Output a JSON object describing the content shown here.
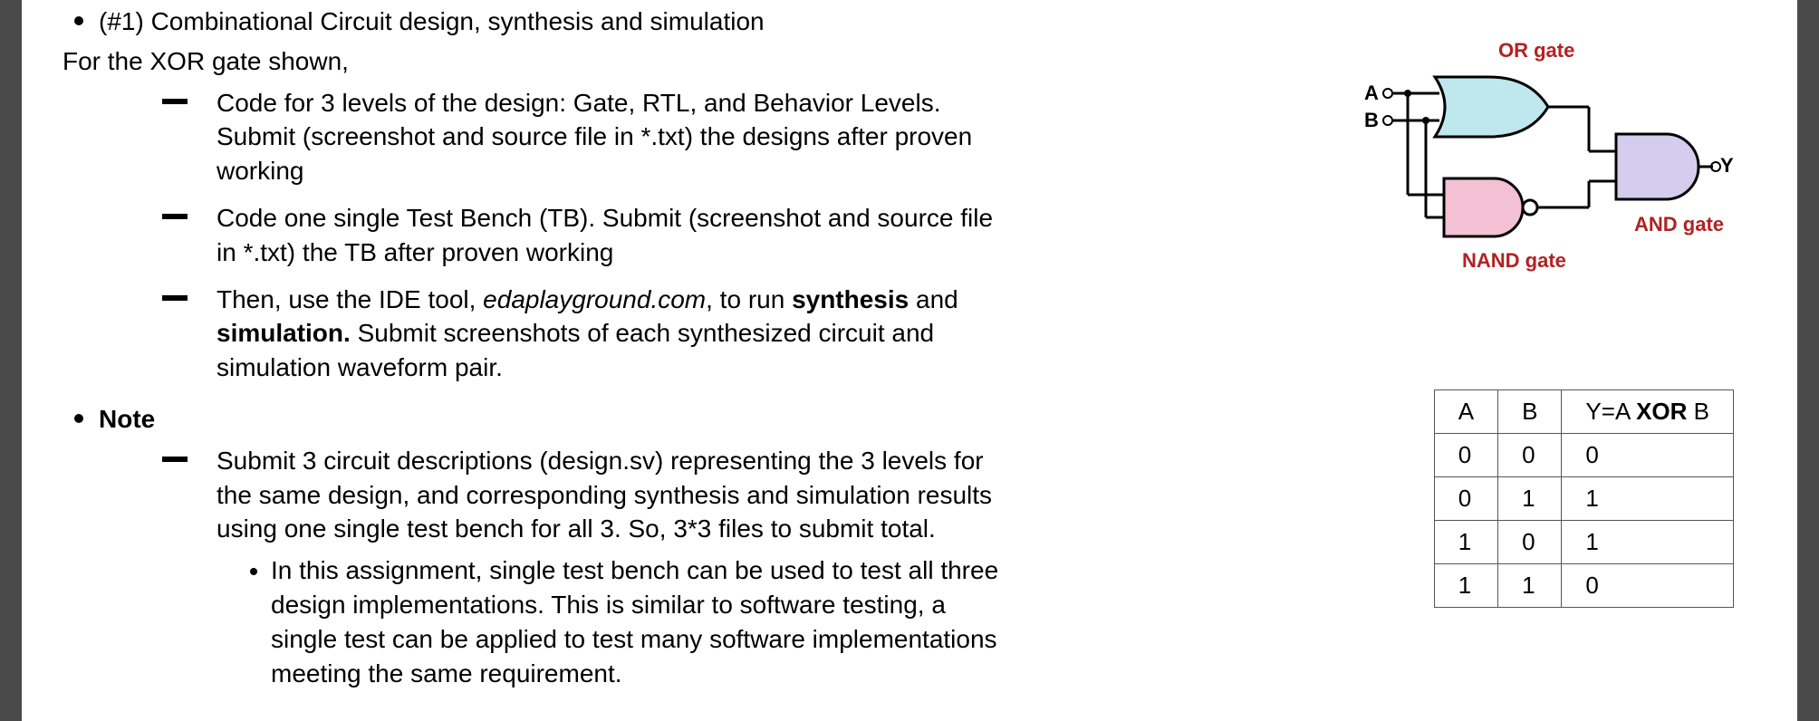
{
  "title_prefix": "(#1) ",
  "title_rest": "Combinational Circuit design, synthesis and simulation",
  "subtitle": "For the XOR gate shown,",
  "bullets_main": [
    {
      "full": "Code for 3 levels of the design: Gate, RTL, and Behavior Levels. Submit (screenshot and source file in *.txt) the designs after proven working"
    },
    {
      "full": "Code one single Test Bench (TB). Submit (screenshot and source file in *.txt) the TB after proven working"
    },
    {
      "pre": "Then, use the IDE tool, ",
      "em": "edaplayground.com",
      "mid": ", to run ",
      "b1": "synthesis",
      "mid2": " and ",
      "b2": "simulation.",
      "post": " Submit screenshots of each synthesized circuit and simulation waveform pair."
    }
  ],
  "note_label": "Note",
  "note_items": [
    {
      "full": "Submit 3 circuit descriptions (design.sv) representing the 3 levels for the same design, and corresponding synthesis and simulation results using one single test bench for all 3.  So, 3*3 files to submit total."
    }
  ],
  "note_sub": "In this assignment, single test bench can be used to test all three design implementations. This is similar to software testing, a single test can be applied to test many software implementations meeting the same requirement.",
  "diagram": {
    "or_label": "OR gate",
    "nand_label": "NAND gate",
    "and_label": "AND gate",
    "a": "A",
    "b": "B",
    "y": "Y"
  },
  "chart_data": {
    "type": "table",
    "title": "XOR truth table",
    "columns": [
      "A",
      "B",
      "Y=A XOR B"
    ],
    "header_y_prefix": "Y=A ",
    "header_y_bold": "XOR",
    "header_y_suffix": " B",
    "rows": [
      [
        "0",
        "0",
        "0"
      ],
      [
        "0",
        "1",
        "1"
      ],
      [
        "1",
        "0",
        "1"
      ],
      [
        "1",
        "1",
        "0"
      ]
    ]
  }
}
